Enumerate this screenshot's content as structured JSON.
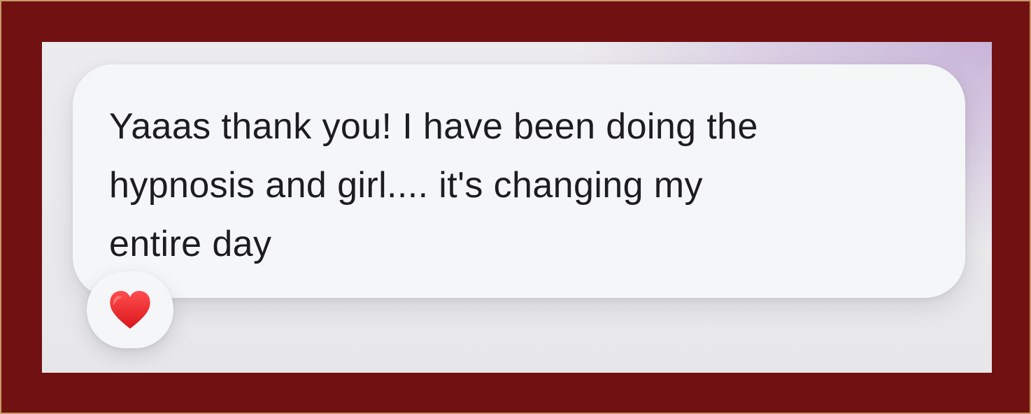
{
  "message": {
    "text": "Yaaas thank you! I have been doing the\nhypnosis and girl.... it's changing my\nentire day"
  },
  "reaction": {
    "icon": "heart-icon",
    "color": "#e8262a"
  },
  "colors": {
    "frame": "#721112",
    "background": "#ececee",
    "bubble": "#f5f6f8",
    "text": "#1d1d1f",
    "gradient_accent": "#c9b5d9"
  }
}
